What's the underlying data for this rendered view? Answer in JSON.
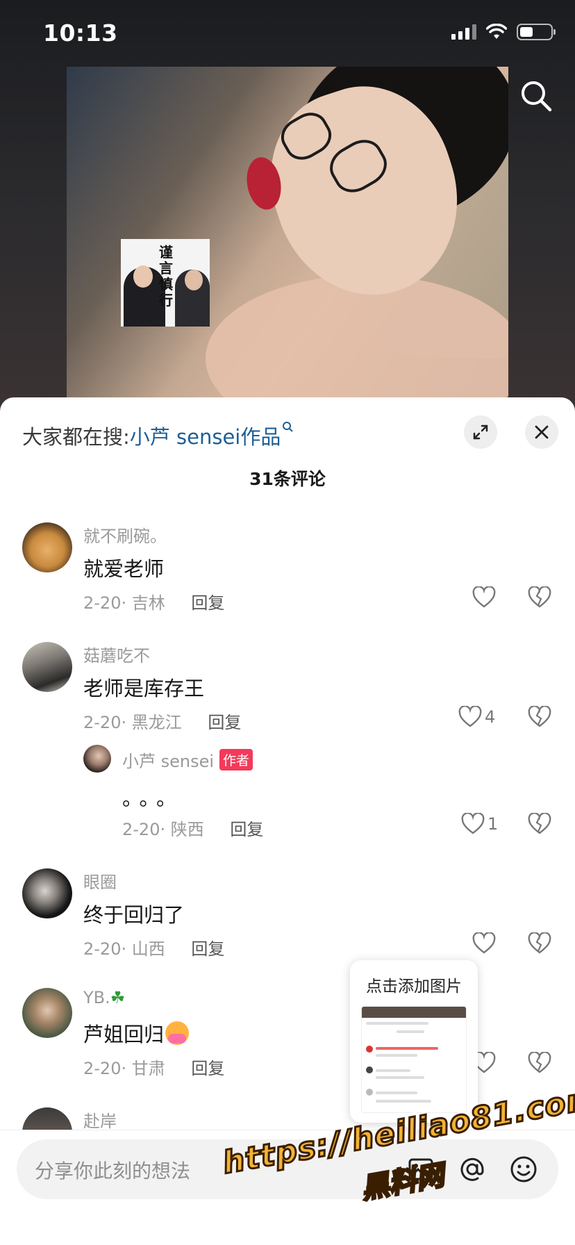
{
  "status_bar": {
    "time": "10:13"
  },
  "video": {
    "sticker_text": "谨言慎行"
  },
  "sheet": {
    "hot_search_prefix": "大家都在搜:",
    "hot_search_keyword": "小芦 sensei作品",
    "comment_count_label": "31条评论"
  },
  "comments": [
    {
      "user": "就不刷碗。",
      "text": "就爱老师",
      "date": "2-20",
      "location": "吉林",
      "reply_label": "回复",
      "likes": ""
    },
    {
      "user": "菇蘑吃不",
      "text": "老师是库存王",
      "date": "2-20",
      "location": "黑龙江",
      "reply_label": "回复",
      "likes": "4",
      "reply": {
        "user": "小芦 sensei",
        "badge": "作者",
        "text": "。。。",
        "date": "2-20",
        "location": "陕西",
        "reply_label": "回复",
        "likes": "1"
      }
    },
    {
      "user": "眼圈",
      "text": "终于回归了",
      "date": "2-20",
      "location": "山西",
      "reply_label": "回复",
      "likes": ""
    },
    {
      "user": "YB.",
      "text": "芦姐回归",
      "date": "2-20",
      "location": "甘肃",
      "reply_label": "回复",
      "likes": ""
    },
    {
      "user": "赴岸",
      "text": "",
      "date": "",
      "location": "",
      "reply_label": "",
      "likes": ""
    }
  ],
  "popup": {
    "title": "点击添加图片"
  },
  "input": {
    "placeholder": "分享你此刻的想法"
  },
  "watermark": {
    "line1": "https://heiliao81.com",
    "line2": "黑料网"
  },
  "icons": {
    "search": "search-icon",
    "expand": "expand-icon",
    "close": "close-icon",
    "like": "heart-icon",
    "dislike": "broken-heart-icon",
    "image": "image-icon",
    "mention": "at-icon",
    "emoji": "emoji-icon"
  },
  "colors": {
    "accent_link": "#1d5f96",
    "author_badge": "#f33a5a",
    "watermark": "#f2b335"
  }
}
